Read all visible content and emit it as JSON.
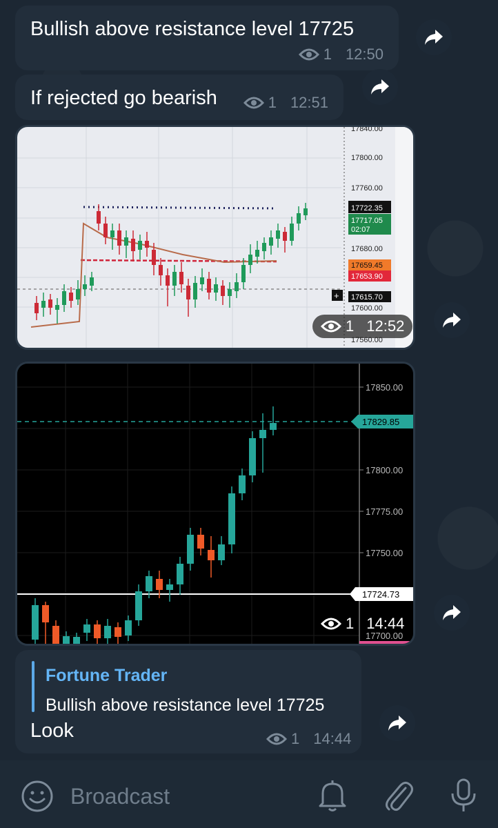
{
  "messages": [
    {
      "text": "Bullish above resistance level 17725",
      "views": "1",
      "time": "12:50"
    },
    {
      "text": "If rejected go bearish",
      "views": "1",
      "time": "12:51"
    },
    {
      "views": "1",
      "time": "12:52"
    },
    {
      "views": "1",
      "time": "14:44"
    },
    {
      "reply_author": "Fortune Trader",
      "reply_text": "Bullish above resistance level 17725",
      "text": "Look",
      "views": "1",
      "time": "14:44"
    }
  ],
  "chart1": {
    "price_labels": [
      "17840.00",
      "17800.00",
      "17760.00",
      "17722.35",
      "17717.05",
      "02:07",
      "17680.00",
      "17659.45",
      "17653.90",
      "17615.70",
      "17600.00",
      "17560.00"
    ]
  },
  "chart2": {
    "price_labels": [
      "17850.00",
      "17829.85",
      "17800.00",
      "17775.00",
      "17750.00",
      "17724.73",
      "17700.00"
    ]
  },
  "input": {
    "placeholder": "Broadcast"
  },
  "colors": {
    "bubble": "#222e3b",
    "accent": "#64b5f6",
    "bull": "#26a69a",
    "bear": "#ef5a28"
  },
  "icons": [
    "eye-icon",
    "forward-icon",
    "emoji-icon",
    "bell-icon",
    "attach-icon",
    "mic-icon"
  ]
}
